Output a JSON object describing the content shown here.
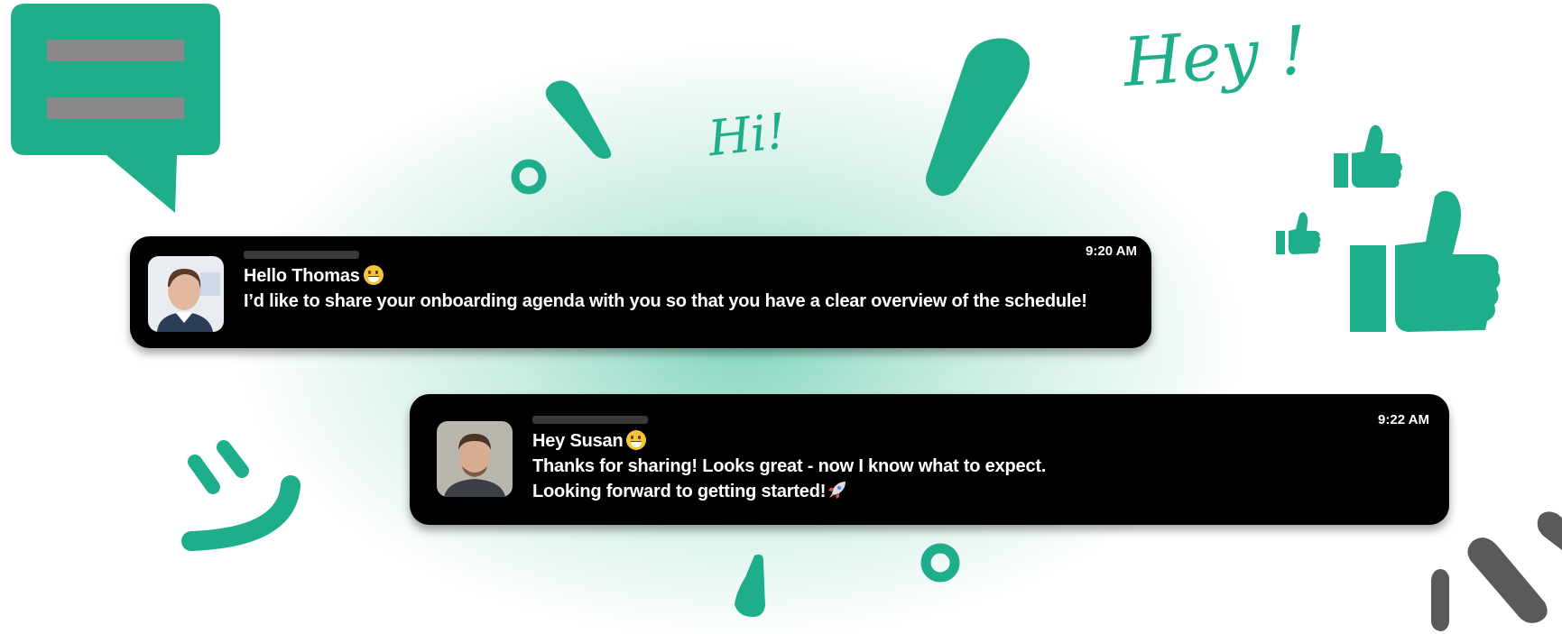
{
  "doodles": {
    "hi": "Hi!",
    "hey": "Hey !"
  },
  "colors": {
    "accent": "#1fae8b",
    "card_bg": "#000000",
    "text": "#ffffff"
  },
  "messages": [
    {
      "time": "9:20 AM",
      "greeting": "Hello Thomas",
      "lines": [
        "I’d like to share your onboarding agenda with you so that you have a clear overview of the schedule!"
      ],
      "emoji": "grinning-face-icon"
    },
    {
      "time": "9:22 AM",
      "greeting": "Hey Susan",
      "lines": [
        "Thanks for sharing! Looks great - now I know what to expect.",
        "Looking forward to getting started!"
      ],
      "emoji": "grinning-face-icon",
      "end_icon": "rocket-icon"
    }
  ]
}
